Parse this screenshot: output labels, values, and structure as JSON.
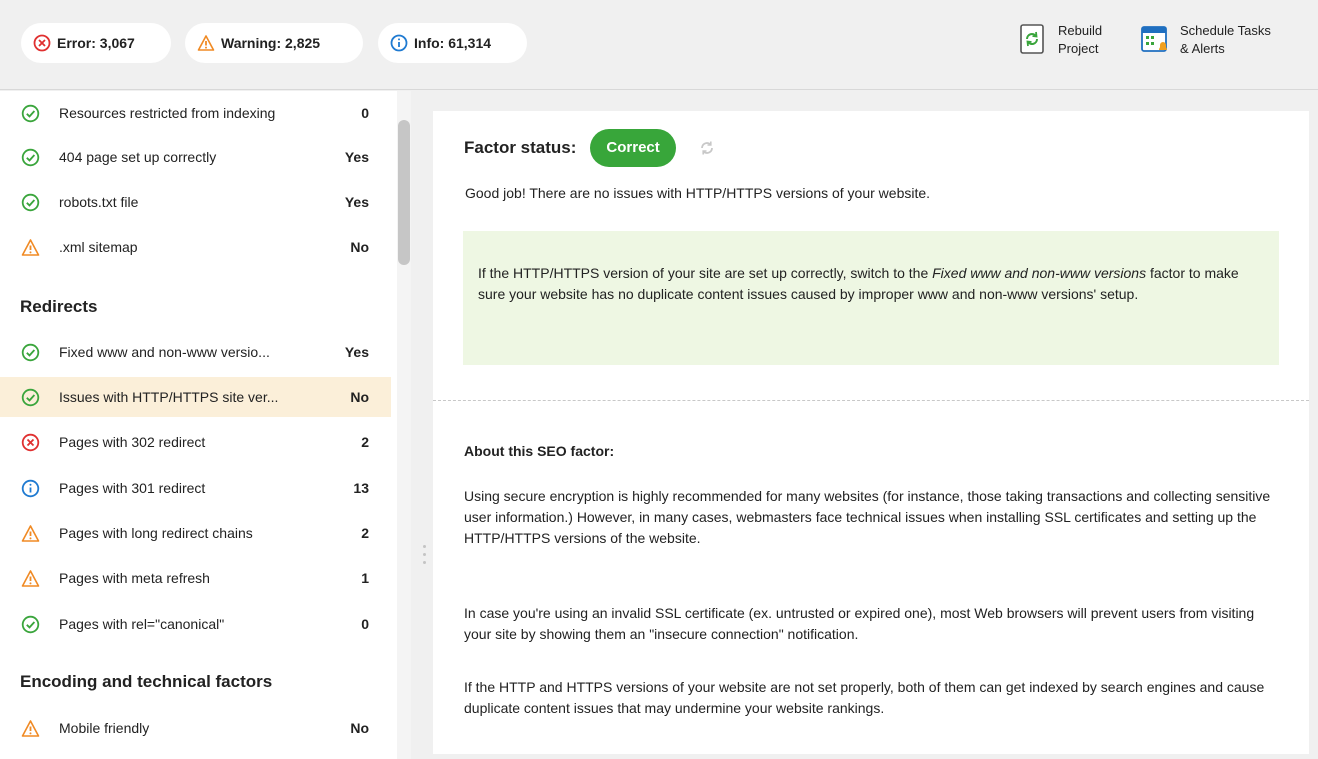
{
  "summary": {
    "error_label": "Error: 3,067",
    "warning_label": "Warning: 2,825",
    "info_label": "Info: 61,314"
  },
  "toolbar": {
    "rebuild_line1": "Rebuild",
    "rebuild_line2": "Project",
    "schedule_line1": "Schedule Tasks",
    "schedule_line2": "& Alerts"
  },
  "sidebar": {
    "top_items": [
      {
        "status": "correct",
        "label": "Resources restricted from indexing",
        "value": "0"
      },
      {
        "status": "correct",
        "label": "404 page set up correctly",
        "value": "Yes"
      },
      {
        "status": "correct",
        "label": "robots.txt file",
        "value": "Yes"
      },
      {
        "status": "warning",
        "label": ".xml sitemap",
        "value": "No"
      }
    ],
    "redirects_title": "Redirects",
    "redirects": [
      {
        "status": "correct",
        "label": "Fixed www and non-www versio...",
        "value": "Yes"
      },
      {
        "status": "correct",
        "label": "Issues with HTTP/HTTPS site ver...",
        "value": "No"
      },
      {
        "status": "error",
        "label": "Pages with 302 redirect",
        "value": "2"
      },
      {
        "status": "info",
        "label": "Pages with 301 redirect",
        "value": "13"
      },
      {
        "status": "warning",
        "label": "Pages with long redirect chains",
        "value": "2"
      },
      {
        "status": "warning",
        "label": "Pages with meta refresh",
        "value": "1"
      },
      {
        "status": "correct",
        "label": "Pages with rel=\"canonical\"",
        "value": "0"
      }
    ],
    "encoding_title": "Encoding and technical factors",
    "encoding": [
      {
        "status": "warning",
        "label": "Mobile friendly",
        "value": "No"
      }
    ]
  },
  "detail": {
    "factor_status_label": "Factor status:",
    "status_badge": "Correct",
    "good_job": "Good job! There are no issues with HTTP/HTTPS versions of your website.",
    "hint_part1": "If the HTTP/HTTPS version of your site are set up correctly, switch to the ",
    "hint_italic": "Fixed www and non-www versions",
    "hint_part2": " factor to make sure your website has no duplicate content issues caused by improper www and non-www versions' setup.",
    "about_title": "About this SEO factor:",
    "para1": "Using secure encryption is highly recommended for many websites (for instance, those taking transactions and collecting sensitive user information.) However, in many cases, webmasters face technical issues when installing SSL certificates and setting up the HTTP/HTTPS versions of the website.",
    "para2": "In case you're using an invalid SSL certificate (ex. untrusted or expired one), most Web browsers will prevent users from visiting your site by showing them an \"insecure connection\" notification.",
    "para3": "If the HTTP and HTTPS versions of your website are not set properly, both of them can get indexed by search engines and cause duplicate content issues that may undermine your website rankings."
  },
  "colors": {
    "correct": "#3aa53c",
    "warning": "#f08a24",
    "error": "#e03030",
    "info": "#1f7ad1",
    "selected_row": "#fbefd9",
    "hint_bg": "#eef7e3"
  }
}
